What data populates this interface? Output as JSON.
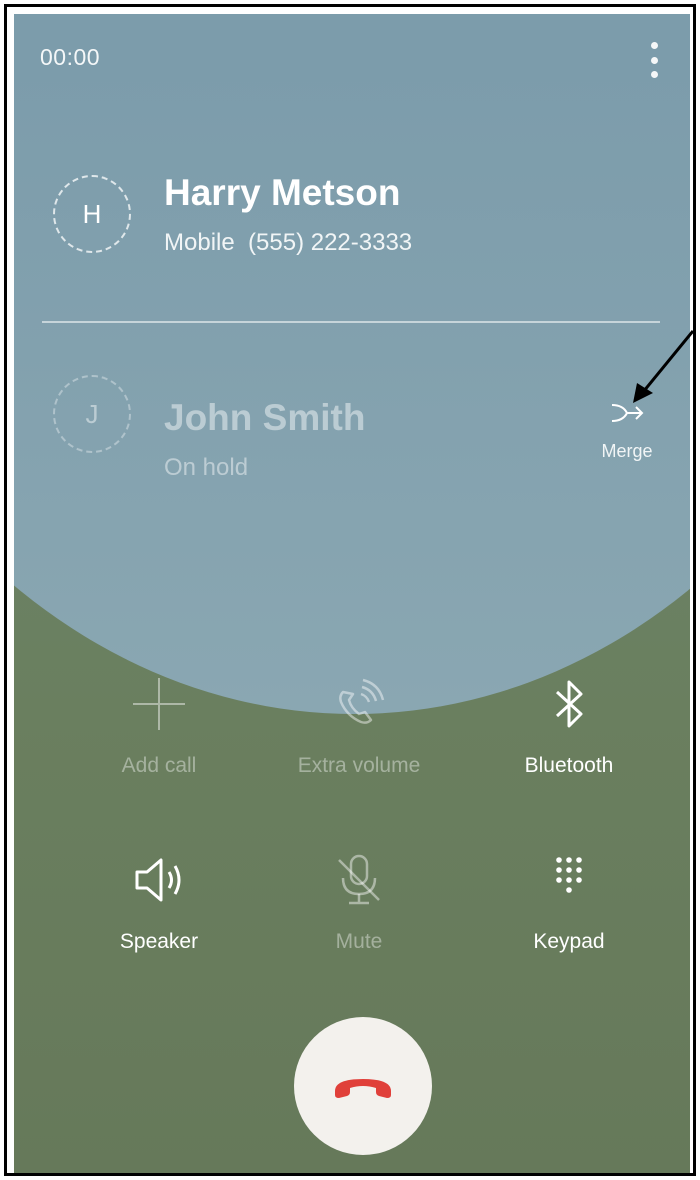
{
  "status_bar": {
    "time": "00:00",
    "menu_icon": "more-vert-icon"
  },
  "active_call": {
    "avatar_letter": "H",
    "name": "Harry Metson",
    "detail": "Mobile  (555) 222-3333"
  },
  "held_call": {
    "avatar_letter": "J",
    "name": "John Smith",
    "status": "On hold",
    "merge_label": "Merge",
    "merge_icon": "merge-icon"
  },
  "controls": [
    {
      "label": "Add call",
      "icon": "add-icon",
      "enabled": false
    },
    {
      "label": "Extra volume",
      "icon": "extra-volume-icon",
      "enabled": false
    },
    {
      "label": "Bluetooth",
      "icon": "bluetooth-icon",
      "enabled": true
    },
    {
      "label": "Speaker",
      "icon": "speaker-icon",
      "enabled": true
    },
    {
      "label": "Mute",
      "icon": "mic-off-icon",
      "enabled": false
    },
    {
      "label": "Keypad",
      "icon": "keypad-icon",
      "enabled": true
    }
  ],
  "end_call": {
    "icon": "end-call-icon",
    "color": "#e0403a"
  },
  "colors": {
    "background_green": "#6a7f5f",
    "background_blue": "#7c9cab",
    "end_call_button": "#f3f1ed"
  }
}
